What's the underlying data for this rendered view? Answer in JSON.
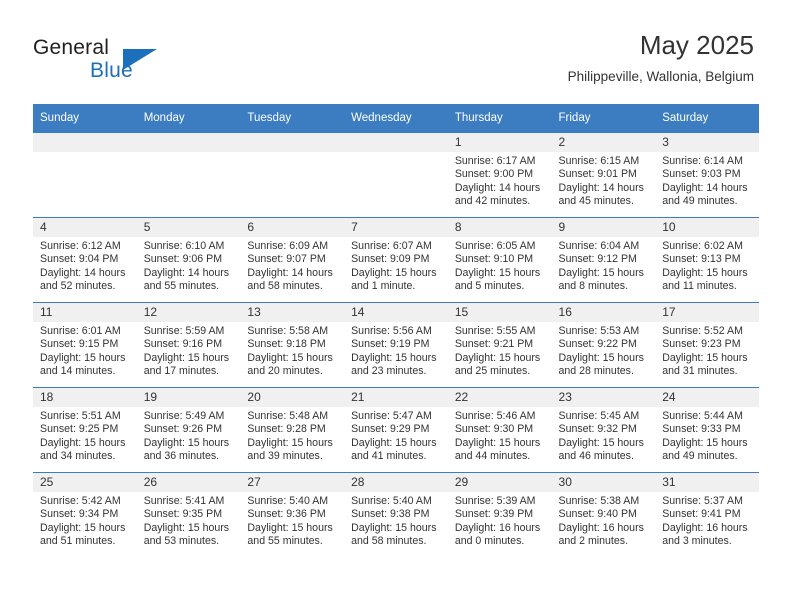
{
  "brand": {
    "name_top": "General",
    "name_bottom": "Blue",
    "accent_color": "#1c6fba",
    "flag_icon": "triangle-flag-icon"
  },
  "header": {
    "title": "May 2025",
    "subtitle": "Philippeville, Wallonia, Belgium"
  },
  "calendar": {
    "header_bg": "#3b7dc0",
    "daynum_band_bg": "#f0f0f0",
    "weekday_headers": [
      "Sunday",
      "Monday",
      "Tuesday",
      "Wednesday",
      "Thursday",
      "Friday",
      "Saturday"
    ],
    "weeks": [
      [
        {
          "day": "",
          "empty": true,
          "lines": []
        },
        {
          "day": "",
          "empty": true,
          "lines": []
        },
        {
          "day": "",
          "empty": true,
          "lines": []
        },
        {
          "day": "",
          "empty": true,
          "lines": []
        },
        {
          "day": "1",
          "lines": [
            "Sunrise: 6:17 AM",
            "Sunset: 9:00 PM",
            "Daylight: 14 hours",
            "and 42 minutes."
          ]
        },
        {
          "day": "2",
          "lines": [
            "Sunrise: 6:15 AM",
            "Sunset: 9:01 PM",
            "Daylight: 14 hours",
            "and 45 minutes."
          ]
        },
        {
          "day": "3",
          "lines": [
            "Sunrise: 6:14 AM",
            "Sunset: 9:03 PM",
            "Daylight: 14 hours",
            "and 49 minutes."
          ]
        }
      ],
      [
        {
          "day": "4",
          "lines": [
            "Sunrise: 6:12 AM",
            "Sunset: 9:04 PM",
            "Daylight: 14 hours",
            "and 52 minutes."
          ]
        },
        {
          "day": "5",
          "lines": [
            "Sunrise: 6:10 AM",
            "Sunset: 9:06 PM",
            "Daylight: 14 hours",
            "and 55 minutes."
          ]
        },
        {
          "day": "6",
          "lines": [
            "Sunrise: 6:09 AM",
            "Sunset: 9:07 PM",
            "Daylight: 14 hours",
            "and 58 minutes."
          ]
        },
        {
          "day": "7",
          "lines": [
            "Sunrise: 6:07 AM",
            "Sunset: 9:09 PM",
            "Daylight: 15 hours",
            "and 1 minute."
          ]
        },
        {
          "day": "8",
          "lines": [
            "Sunrise: 6:05 AM",
            "Sunset: 9:10 PM",
            "Daylight: 15 hours",
            "and 5 minutes."
          ]
        },
        {
          "day": "9",
          "lines": [
            "Sunrise: 6:04 AM",
            "Sunset: 9:12 PM",
            "Daylight: 15 hours",
            "and 8 minutes."
          ]
        },
        {
          "day": "10",
          "lines": [
            "Sunrise: 6:02 AM",
            "Sunset: 9:13 PM",
            "Daylight: 15 hours",
            "and 11 minutes."
          ]
        }
      ],
      [
        {
          "day": "11",
          "lines": [
            "Sunrise: 6:01 AM",
            "Sunset: 9:15 PM",
            "Daylight: 15 hours",
            "and 14 minutes."
          ]
        },
        {
          "day": "12",
          "lines": [
            "Sunrise: 5:59 AM",
            "Sunset: 9:16 PM",
            "Daylight: 15 hours",
            "and 17 minutes."
          ]
        },
        {
          "day": "13",
          "lines": [
            "Sunrise: 5:58 AM",
            "Sunset: 9:18 PM",
            "Daylight: 15 hours",
            "and 20 minutes."
          ]
        },
        {
          "day": "14",
          "lines": [
            "Sunrise: 5:56 AM",
            "Sunset: 9:19 PM",
            "Daylight: 15 hours",
            "and 23 minutes."
          ]
        },
        {
          "day": "15",
          "lines": [
            "Sunrise: 5:55 AM",
            "Sunset: 9:21 PM",
            "Daylight: 15 hours",
            "and 25 minutes."
          ]
        },
        {
          "day": "16",
          "lines": [
            "Sunrise: 5:53 AM",
            "Sunset: 9:22 PM",
            "Daylight: 15 hours",
            "and 28 minutes."
          ]
        },
        {
          "day": "17",
          "lines": [
            "Sunrise: 5:52 AM",
            "Sunset: 9:23 PM",
            "Daylight: 15 hours",
            "and 31 minutes."
          ]
        }
      ],
      [
        {
          "day": "18",
          "lines": [
            "Sunrise: 5:51 AM",
            "Sunset: 9:25 PM",
            "Daylight: 15 hours",
            "and 34 minutes."
          ]
        },
        {
          "day": "19",
          "lines": [
            "Sunrise: 5:49 AM",
            "Sunset: 9:26 PM",
            "Daylight: 15 hours",
            "and 36 minutes."
          ]
        },
        {
          "day": "20",
          "lines": [
            "Sunrise: 5:48 AM",
            "Sunset: 9:28 PM",
            "Daylight: 15 hours",
            "and 39 minutes."
          ]
        },
        {
          "day": "21",
          "lines": [
            "Sunrise: 5:47 AM",
            "Sunset: 9:29 PM",
            "Daylight: 15 hours",
            "and 41 minutes."
          ]
        },
        {
          "day": "22",
          "lines": [
            "Sunrise: 5:46 AM",
            "Sunset: 9:30 PM",
            "Daylight: 15 hours",
            "and 44 minutes."
          ]
        },
        {
          "day": "23",
          "lines": [
            "Sunrise: 5:45 AM",
            "Sunset: 9:32 PM",
            "Daylight: 15 hours",
            "and 46 minutes."
          ]
        },
        {
          "day": "24",
          "lines": [
            "Sunrise: 5:44 AM",
            "Sunset: 9:33 PM",
            "Daylight: 15 hours",
            "and 49 minutes."
          ]
        }
      ],
      [
        {
          "day": "25",
          "lines": [
            "Sunrise: 5:42 AM",
            "Sunset: 9:34 PM",
            "Daylight: 15 hours",
            "and 51 minutes."
          ]
        },
        {
          "day": "26",
          "lines": [
            "Sunrise: 5:41 AM",
            "Sunset: 9:35 PM",
            "Daylight: 15 hours",
            "and 53 minutes."
          ]
        },
        {
          "day": "27",
          "lines": [
            "Sunrise: 5:40 AM",
            "Sunset: 9:36 PM",
            "Daylight: 15 hours",
            "and 55 minutes."
          ]
        },
        {
          "day": "28",
          "lines": [
            "Sunrise: 5:40 AM",
            "Sunset: 9:38 PM",
            "Daylight: 15 hours",
            "and 58 minutes."
          ]
        },
        {
          "day": "29",
          "lines": [
            "Sunrise: 5:39 AM",
            "Sunset: 9:39 PM",
            "Daylight: 16 hours",
            "and 0 minutes."
          ]
        },
        {
          "day": "30",
          "lines": [
            "Sunrise: 5:38 AM",
            "Sunset: 9:40 PM",
            "Daylight: 16 hours",
            "and 2 minutes."
          ]
        },
        {
          "day": "31",
          "lines": [
            "Sunrise: 5:37 AM",
            "Sunset: 9:41 PM",
            "Daylight: 16 hours",
            "and 3 minutes."
          ]
        }
      ]
    ]
  }
}
